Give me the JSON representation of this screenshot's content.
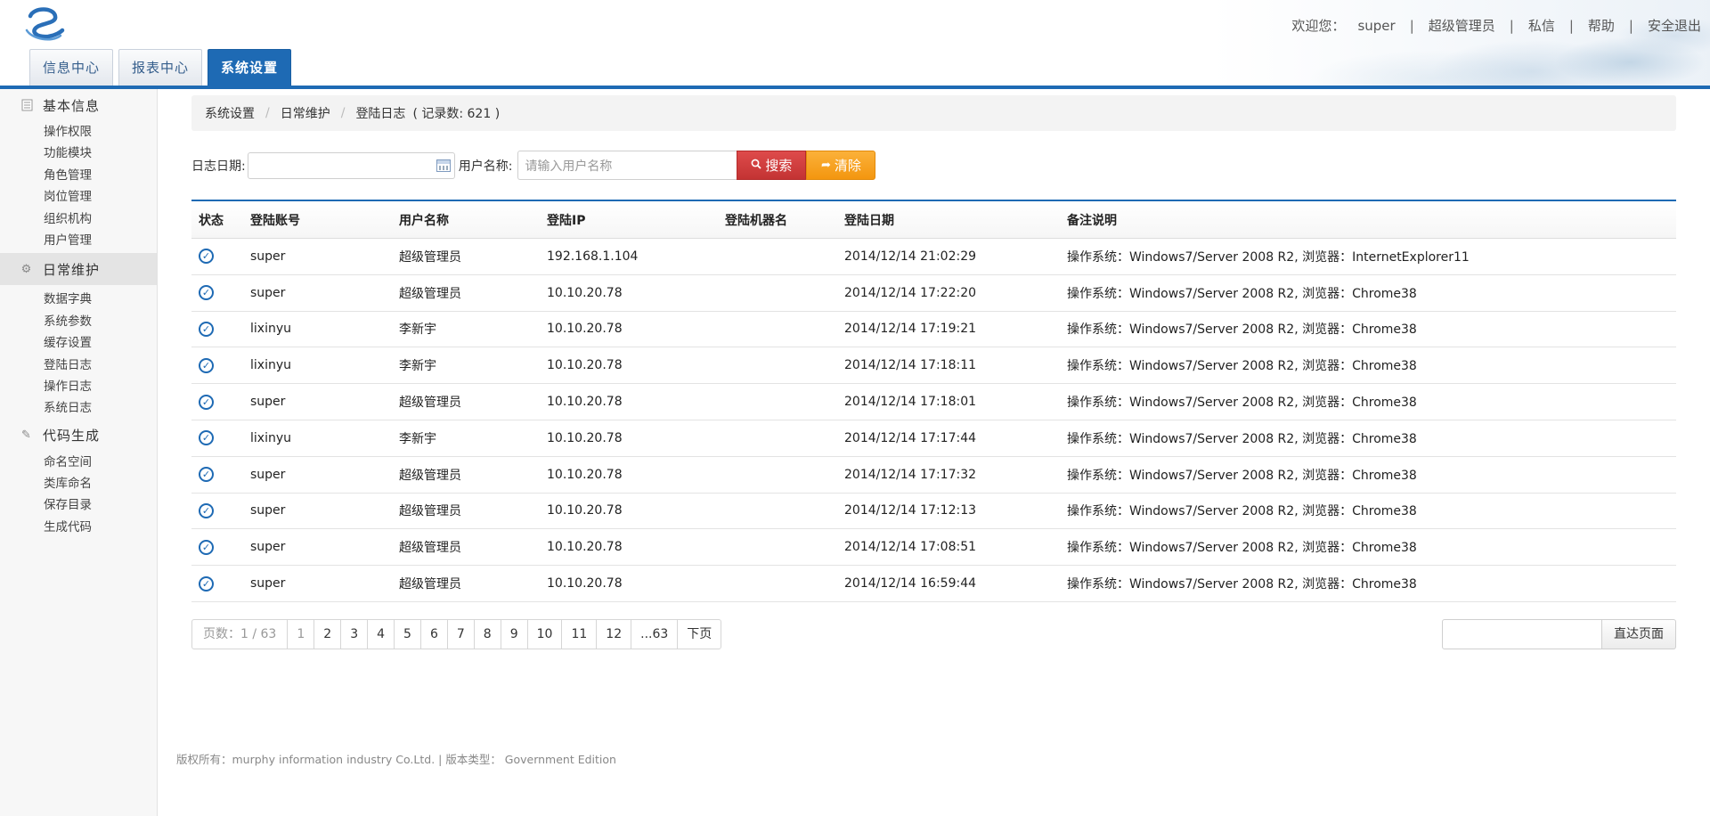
{
  "header": {
    "welcome": "欢迎您：",
    "user": "super",
    "links": [
      "超级管理员",
      "私信",
      "帮助",
      "安全退出"
    ],
    "tabs": [
      "信息中心",
      "报表中心",
      "系统设置"
    ],
    "active_tab": 2,
    "accent_color": "#1e6ab4"
  },
  "sidebar": {
    "groups": [
      {
        "title": "基本信息",
        "icon": "document-icon",
        "items": [
          "操作权限",
          "功能模块",
          "角色管理",
          "岗位管理",
          "组织机构",
          "用户管理"
        ]
      },
      {
        "title": "日常维护",
        "icon": "gear-icon",
        "active": true,
        "items": [
          "数据字典",
          "系统参数",
          "缓存设置",
          "登陆日志",
          "操作日志",
          "系统日志"
        ]
      },
      {
        "title": "代码生成",
        "icon": "pencil-icon",
        "items": [
          "命名空间",
          "类库命名",
          "保存目录",
          "生成代码"
        ]
      }
    ]
  },
  "breadcrumb": {
    "items": [
      "系统设置",
      "日常维护",
      "登陆日志"
    ],
    "count": "( 记录数: 621 )"
  },
  "filter": {
    "date_label": "日志日期:",
    "date_value": "",
    "user_label": "用户名称:",
    "user_placeholder": "请输入用户名称",
    "search_label": "搜索",
    "clear_label": "清除"
  },
  "table": {
    "columns": [
      "状态",
      "登陆账号",
      "用户名称",
      "登陆IP",
      "登陆机器名",
      "登陆日期",
      "备注说明"
    ],
    "rows": [
      [
        "super",
        "超级管理员",
        "192.168.1.104",
        "",
        "2014/12/14 21:02:29",
        "操作系统：Windows7/Server 2008 R2, 浏览器：InternetExplorer11"
      ],
      [
        "super",
        "超级管理员",
        "10.10.20.78",
        "",
        "2014/12/14 17:22:20",
        "操作系统：Windows7/Server 2008 R2, 浏览器：Chrome38"
      ],
      [
        "lixinyu",
        "李新宇",
        "10.10.20.78",
        "",
        "2014/12/14 17:19:21",
        "操作系统：Windows7/Server 2008 R2, 浏览器：Chrome38"
      ],
      [
        "lixinyu",
        "李新宇",
        "10.10.20.78",
        "",
        "2014/12/14 17:18:11",
        "操作系统：Windows7/Server 2008 R2, 浏览器：Chrome38"
      ],
      [
        "super",
        "超级管理员",
        "10.10.20.78",
        "",
        "2014/12/14 17:18:01",
        "操作系统：Windows7/Server 2008 R2, 浏览器：Chrome38"
      ],
      [
        "lixinyu",
        "李新宇",
        "10.10.20.78",
        "",
        "2014/12/14 17:17:44",
        "操作系统：Windows7/Server 2008 R2, 浏览器：Chrome38"
      ],
      [
        "super",
        "超级管理员",
        "10.10.20.78",
        "",
        "2014/12/14 17:17:32",
        "操作系统：Windows7/Server 2008 R2, 浏览器：Chrome38"
      ],
      [
        "super",
        "超级管理员",
        "10.10.20.78",
        "",
        "2014/12/14 17:12:13",
        "操作系统：Windows7/Server 2008 R2, 浏览器：Chrome38"
      ],
      [
        "super",
        "超级管理员",
        "10.10.20.78",
        "",
        "2014/12/14 17:08:51",
        "操作系统：Windows7/Server 2008 R2, 浏览器：Chrome38"
      ],
      [
        "super",
        "超级管理员",
        "10.10.20.78",
        "",
        "2014/12/14 16:59:44",
        "操作系统：Windows7/Server 2008 R2, 浏览器：Chrome38"
      ]
    ]
  },
  "pager": {
    "info": "页数：1 / 63",
    "pages": [
      "1",
      "2",
      "3",
      "4",
      "5",
      "6",
      "7",
      "8",
      "9",
      "10",
      "11",
      "12",
      "...63"
    ],
    "current": "1",
    "next": "下页",
    "goto_value": "",
    "goto_label": "直达页面"
  },
  "footer": "版权所有：murphy information industry Co.Ltd. | 版本类型： Government Edition"
}
